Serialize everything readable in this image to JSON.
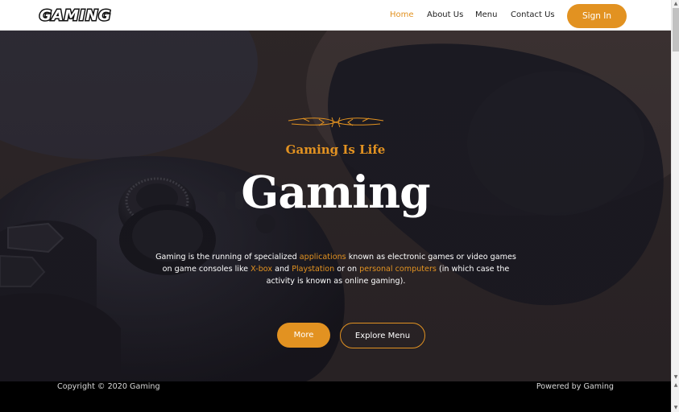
{
  "header": {
    "logo_text": "GAMING",
    "nav": [
      {
        "label": "Home",
        "active": true
      },
      {
        "label": "About Us",
        "active": false
      },
      {
        "label": "Menu",
        "active": false
      },
      {
        "label": "Contact Us",
        "active": false
      }
    ],
    "signin_label": "Sign In"
  },
  "hero": {
    "tagline": "Gaming Is Life",
    "title": "Gaming",
    "desc": {
      "p1": "Gaming is the running of specialized ",
      "l1": "applications",
      "p2": " known as electronic games or video games on game consoles like ",
      "l2": "X-box",
      "p3": " and ",
      "l3": "Playstation",
      "p4": " or on ",
      "l4": "personal computers",
      "p5": " (in which case the activity is known as online gaming)."
    },
    "more_label": "More",
    "explore_label": "Explore Menu"
  },
  "footer": {
    "copyright": "Copyright © 2020 Gaming",
    "powered": "Powered by Gaming"
  },
  "colors": {
    "accent": "#e29221",
    "header_bg": "#ffffff",
    "footer_bg": "#000000"
  },
  "icons": {
    "logo": "gaming-wordmark",
    "ornament": "decorative-flourish",
    "scroll_up": "arrow-up-icon",
    "scroll_down": "arrow-down-icon"
  }
}
